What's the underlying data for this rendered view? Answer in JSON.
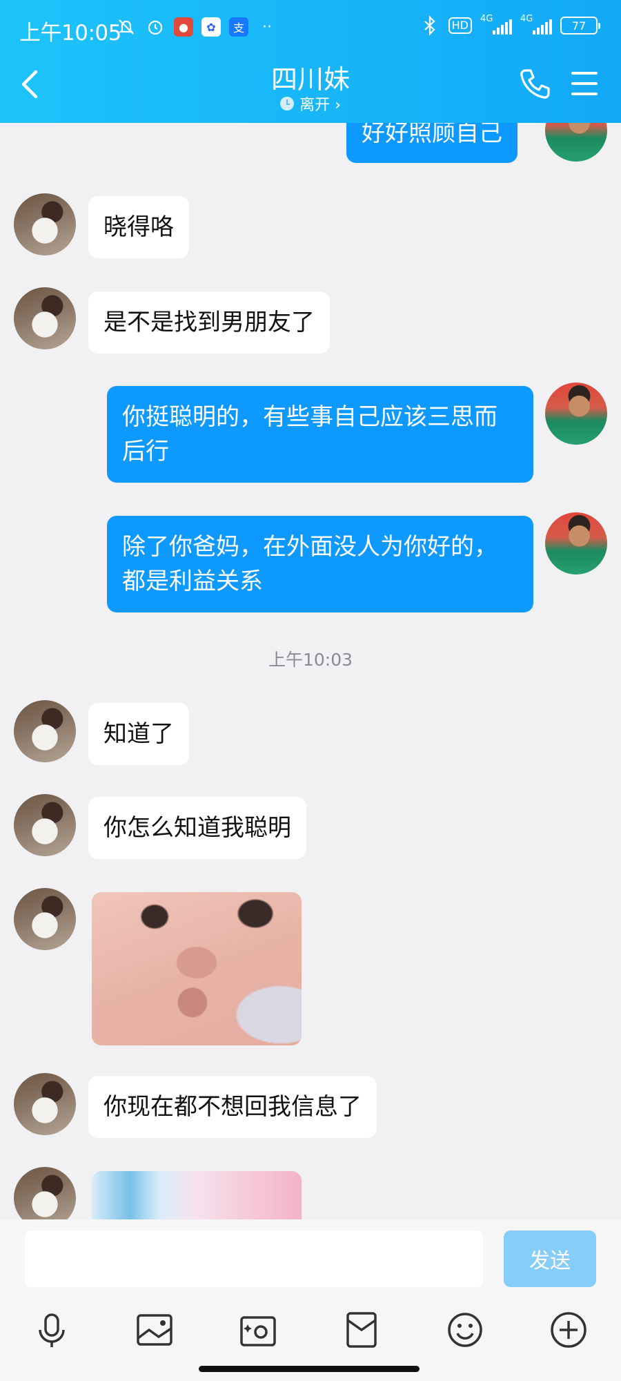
{
  "status_bar": {
    "time": "上午10:05",
    "hd": "HD",
    "net1": "4G",
    "net2": "4G",
    "battery": "77"
  },
  "header": {
    "title": "四川妹",
    "presence": "离开 ›"
  },
  "messages": [
    {
      "side": "out",
      "type": "text",
      "text": "好好照顾自己"
    },
    {
      "side": "in",
      "type": "text",
      "text": "晓得咯"
    },
    {
      "side": "in",
      "type": "text",
      "text": "是不是找到男朋友了"
    },
    {
      "side": "out",
      "type": "text",
      "text": "你挺聪明的，有些事自己应该三思而后行"
    },
    {
      "side": "out",
      "type": "text",
      "text": "除了你爸妈，在外面没人为你好的，都是利益关系"
    },
    {
      "type": "timestamp",
      "text": "上午10:03"
    },
    {
      "side": "in",
      "type": "text",
      "text": "知道了"
    },
    {
      "side": "in",
      "type": "text",
      "text": "你怎么知道我聪明"
    },
    {
      "side": "in",
      "type": "image",
      "image": "baby-face-sticker"
    },
    {
      "side": "in",
      "type": "text",
      "text": "你现在都不想回我信息了"
    },
    {
      "side": "in",
      "type": "image",
      "image": "anime-sticker"
    }
  ],
  "input": {
    "value": "",
    "send_label": "发送"
  },
  "toolbar": [
    "microphone-icon",
    "picture-icon",
    "camera-icon",
    "red-packet-icon",
    "emoji-icon",
    "plus-icon"
  ],
  "colors": {
    "header": "#12a9f7",
    "outgoing_bubble": "#0d99ff",
    "incoming_bubble": "#ffffff",
    "background": "#f1f1f3",
    "send_button": "#86cdfa"
  }
}
